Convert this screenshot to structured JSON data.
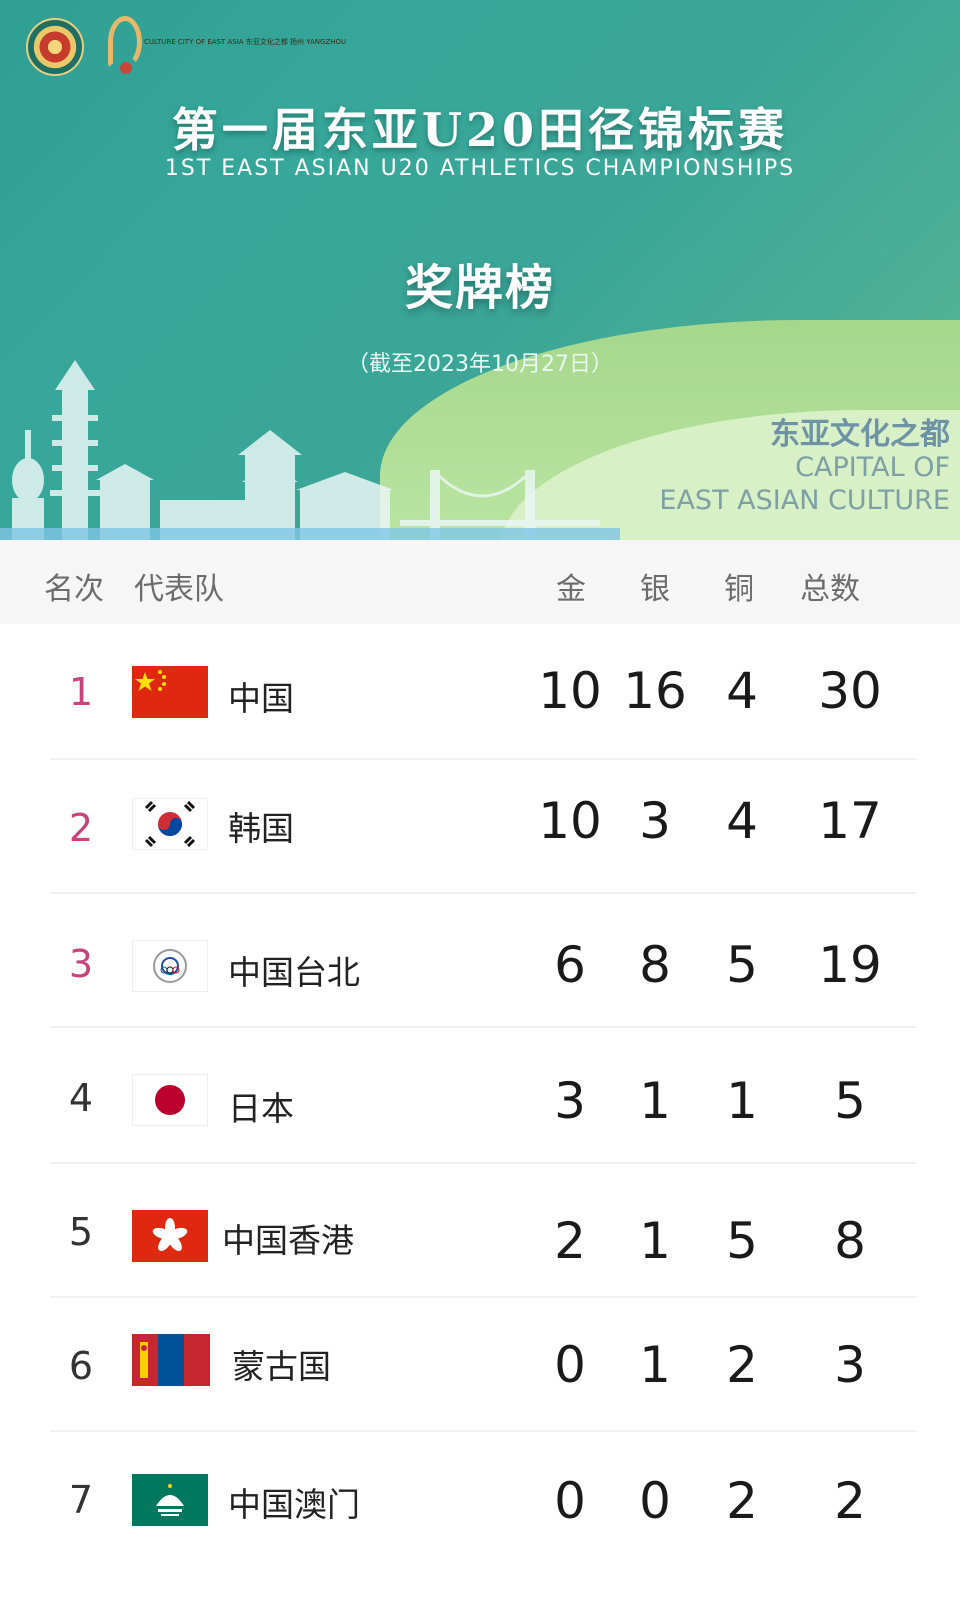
{
  "banner": {
    "logo_city_text": "CULTURE CITY OF EAST ASIA 东亚文化之都 扬州 YANGZHOU",
    "title_cn": "第一届东亚U20田径锦标赛",
    "title_en": "1ST EAST ASIAN U20 ATHLETICS CHAMPIONSHIPS",
    "board_title": "奖牌榜",
    "as_of": "（截至2023年10月27日）",
    "capital_cn": "东亚文化之都",
    "capital_en_1": "CAPITAL OF",
    "capital_en_2": "EAST ASIAN CULTURE"
  },
  "table": {
    "headers": {
      "rank": "名次",
      "team": "代表队",
      "gold": "金",
      "silver": "银",
      "bronze": "铜",
      "total": "总数"
    },
    "rows": [
      {
        "rank": "1",
        "team": "中国",
        "flag": "china-flag-icon",
        "gold": "10",
        "silver": "16",
        "bronze": "4",
        "total": "30"
      },
      {
        "rank": "2",
        "team": "韩国",
        "flag": "korea-flag-icon",
        "gold": "10",
        "silver": "3",
        "bronze": "4",
        "total": "17"
      },
      {
        "rank": "3",
        "team": "中国台北",
        "flag": "chinese-taipei-flag-icon",
        "gold": "6",
        "silver": "8",
        "bronze": "5",
        "total": "19"
      },
      {
        "rank": "4",
        "team": "日本",
        "flag": "japan-flag-icon",
        "gold": "3",
        "silver": "1",
        "bronze": "1",
        "total": "5"
      },
      {
        "rank": "5",
        "team": "中国香港",
        "flag": "hong-kong-flag-icon",
        "gold": "2",
        "silver": "1",
        "bronze": "5",
        "total": "8"
      },
      {
        "rank": "6",
        "team": "蒙古国",
        "flag": "mongolia-flag-icon",
        "gold": "0",
        "silver": "1",
        "bronze": "2",
        "total": "3"
      },
      {
        "rank": "7",
        "team": "中国澳门",
        "flag": "macao-flag-icon",
        "gold": "0",
        "silver": "0",
        "bronze": "2",
        "total": "2"
      }
    ]
  },
  "colors": {
    "banner_teal": "#36a79a",
    "top3_rank": "#c8437a",
    "header_bg": "#f6f6f6"
  }
}
